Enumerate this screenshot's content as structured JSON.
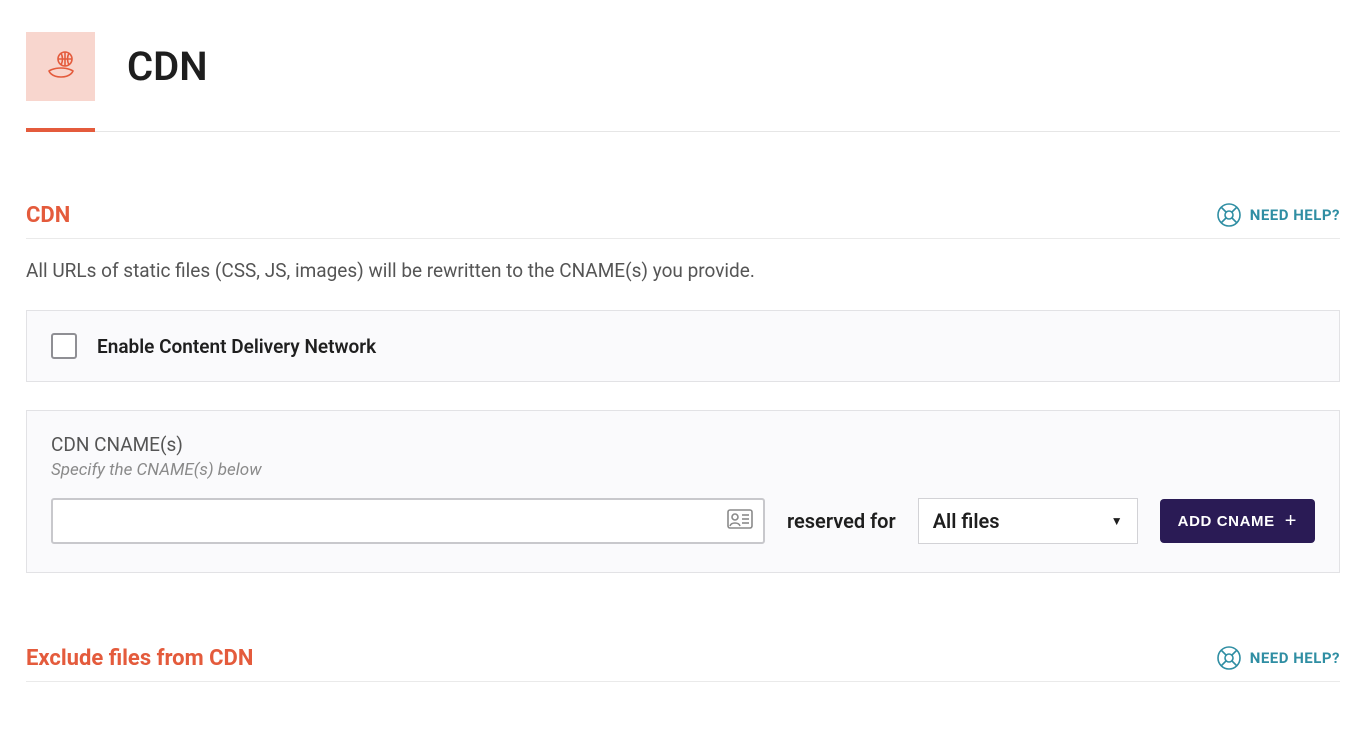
{
  "header": {
    "title": "CDN"
  },
  "cdn_section": {
    "title": "CDN",
    "help_label": "NEED HELP?",
    "description": "All URLs of static files (CSS, JS, images) will be rewritten to the CNAME(s) you provide.",
    "enable_label": "Enable Content Delivery Network",
    "cname_title": "CDN CNAME(s)",
    "cname_sub": "Specify the CNAME(s) below",
    "cname_value": "",
    "reserved_label": "reserved for",
    "select_value": "All files",
    "add_cname_label": "ADD CNAME"
  },
  "exclude_section": {
    "title": "Exclude files from CDN",
    "help_label": "NEED HELP?"
  }
}
